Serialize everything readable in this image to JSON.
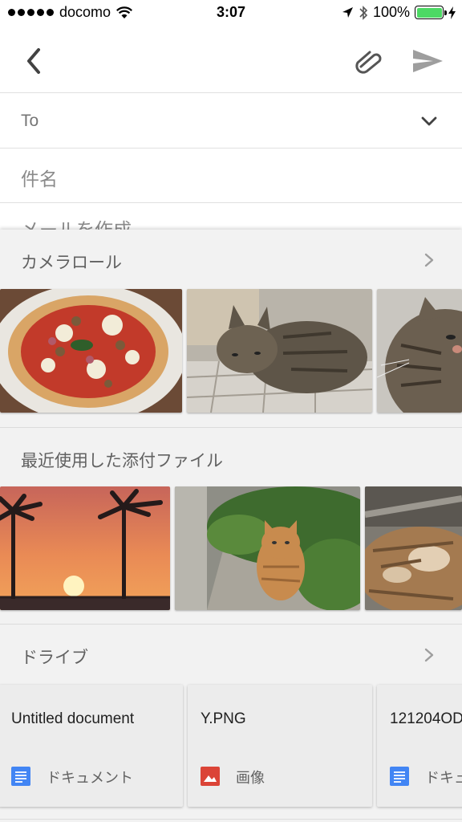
{
  "status_bar": {
    "carrier": "docomo",
    "time": "3:07",
    "battery": "100%",
    "battery_level": 1.0,
    "battery_color": "#4cd964"
  },
  "toolbar": {
    "back_icon": "chevron-left-icon",
    "attach_icon": "paperclip-icon",
    "send_icon": "send-icon"
  },
  "compose": {
    "to_label": "To",
    "subject_placeholder": "件名",
    "body_placeholder": "メールを作成"
  },
  "panel": {
    "camera_roll": {
      "title": "カメラロール",
      "photos": [
        "pizza",
        "tabby-cat-on-tiles",
        "tabby-cat-closeup"
      ]
    },
    "recent_attachments": {
      "title": "最近使用した添付ファイル",
      "photos": [
        "palm-tree-sunset",
        "orange-cat-in-garden",
        "cat-paws"
      ]
    },
    "drive": {
      "title": "ドライブ",
      "files": [
        {
          "name": "Untitled document",
          "type": "ドキュメント",
          "icon": "docs-icon",
          "icon_color": "#4285f4"
        },
        {
          "name": "Y.PNG",
          "type": "画像",
          "icon": "image-icon",
          "icon_color": "#db4437"
        },
        {
          "name": "121204OD",
          "type": "ドキュ",
          "icon": "docs-icon",
          "icon_color": "#4285f4"
        }
      ]
    }
  }
}
